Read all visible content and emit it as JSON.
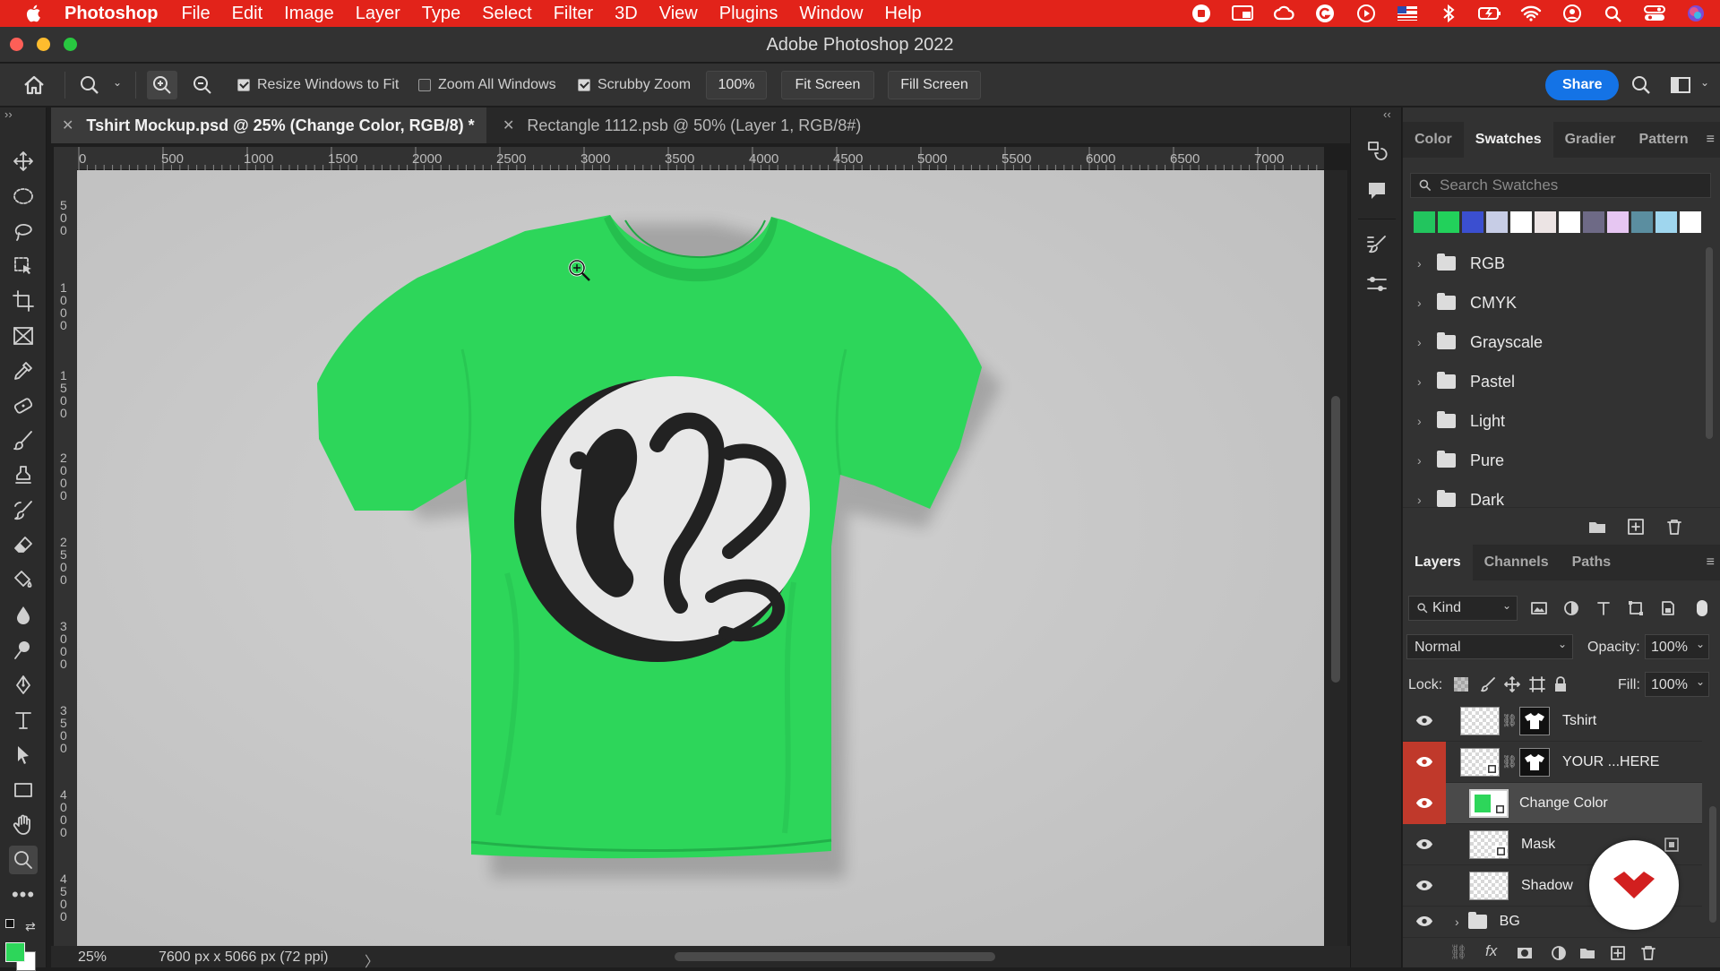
{
  "menubar": {
    "app": "Photoshop",
    "items": [
      "File",
      "Edit",
      "Image",
      "Layer",
      "Type",
      "Select",
      "Filter",
      "3D",
      "View",
      "Plugins",
      "Window",
      "Help"
    ]
  },
  "window": {
    "title": "Adobe Photoshop 2022"
  },
  "options": {
    "resize_label": "Resize Windows to Fit",
    "zoom_all_label": "Zoom All Windows",
    "scrubby_label": "Scrubby Zoom",
    "zoom_value": "100%",
    "fit_screen": "Fit Screen",
    "fill_screen": "Fill Screen",
    "share": "Share"
  },
  "tabs": [
    {
      "label": "Tshirt Mockup.psd @ 25% (Change Color, RGB/8) *",
      "active": true
    },
    {
      "label": "Rectangle 1112.psb @ 50% (Layer 1, RGB/8#)",
      "active": false
    }
  ],
  "rulers": {
    "h": [
      "0",
      "500",
      "1000",
      "1500",
      "2000",
      "2500",
      "3000",
      "3500",
      "4000",
      "4500",
      "5000",
      "5500",
      "6000",
      "6500",
      "7000"
    ],
    "v": [
      "500",
      "1000",
      "1500",
      "2000",
      "2500",
      "3000",
      "3500",
      "4000",
      "4500"
    ]
  },
  "status": {
    "zoom": "25%",
    "doc_info": "7600 px x 5066 px (72 ppi)"
  },
  "swatches_panel": {
    "tabs": [
      "Color",
      "Swatches",
      "Gradier",
      "Pattern"
    ],
    "search_placeholder": "Search Swatches",
    "colors": [
      "#22c55e",
      "#22d15b",
      "#3b4fd0",
      "#c7cde6",
      "#ffffff",
      "#ece4e4",
      "#ffffff",
      "#6e6a86",
      "#e6c6f2",
      "#5b8ea0",
      "#9fd6ee",
      "#ffffff"
    ],
    "groups": [
      "RGB",
      "CMYK",
      "Grayscale",
      "Pastel",
      "Light",
      "Pure",
      "Dark"
    ]
  },
  "layers_panel": {
    "tabs": [
      "Layers",
      "Channels",
      "Paths"
    ],
    "filter": "Kind",
    "blend_mode": "Normal",
    "opacity_label": "Opacity:",
    "opacity": "100%",
    "lock_label": "Lock:",
    "fill_label": "Fill:",
    "fill": "100%",
    "layers": [
      {
        "name": "Tshirt"
      },
      {
        "name": "YOUR ...HERE"
      },
      {
        "name": "Change Color"
      },
      {
        "name": "Mask"
      },
      {
        "name": "Shadow"
      },
      {
        "name": "BG"
      }
    ]
  },
  "colors": {
    "menubar": "#e2231a",
    "shirt": "#2dd65a",
    "accent": "#1473e6",
    "eye_highlight": "#c0392b"
  }
}
